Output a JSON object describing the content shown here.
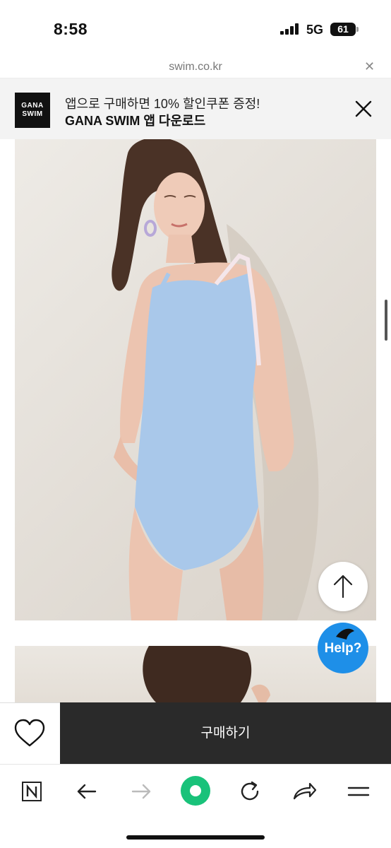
{
  "status_bar": {
    "time": "8:58",
    "network": "5G",
    "battery": "61"
  },
  "url_bar": {
    "domain": "swim.co.kr"
  },
  "app_banner": {
    "logo_line1": "GANA",
    "logo_line2": "SWIM",
    "promo_text": "앱으로 구매하면 10% 할인쿠폰 증정!",
    "download_text": "GANA SWIM 앱 다운로드"
  },
  "floating": {
    "help_label": "Help?"
  },
  "buy_bar": {
    "buy_label": "구매하기"
  },
  "colors": {
    "help_button": "#1e8fe8",
    "buy_button": "#2a2a2a",
    "home_button": "#19c27a"
  },
  "icons": [
    "close-icon",
    "heart-icon",
    "arrow-up-icon",
    "naver-n-icon",
    "back-arrow-icon",
    "forward-arrow-icon",
    "home-icon",
    "refresh-icon",
    "share-icon",
    "menu-icon"
  ]
}
